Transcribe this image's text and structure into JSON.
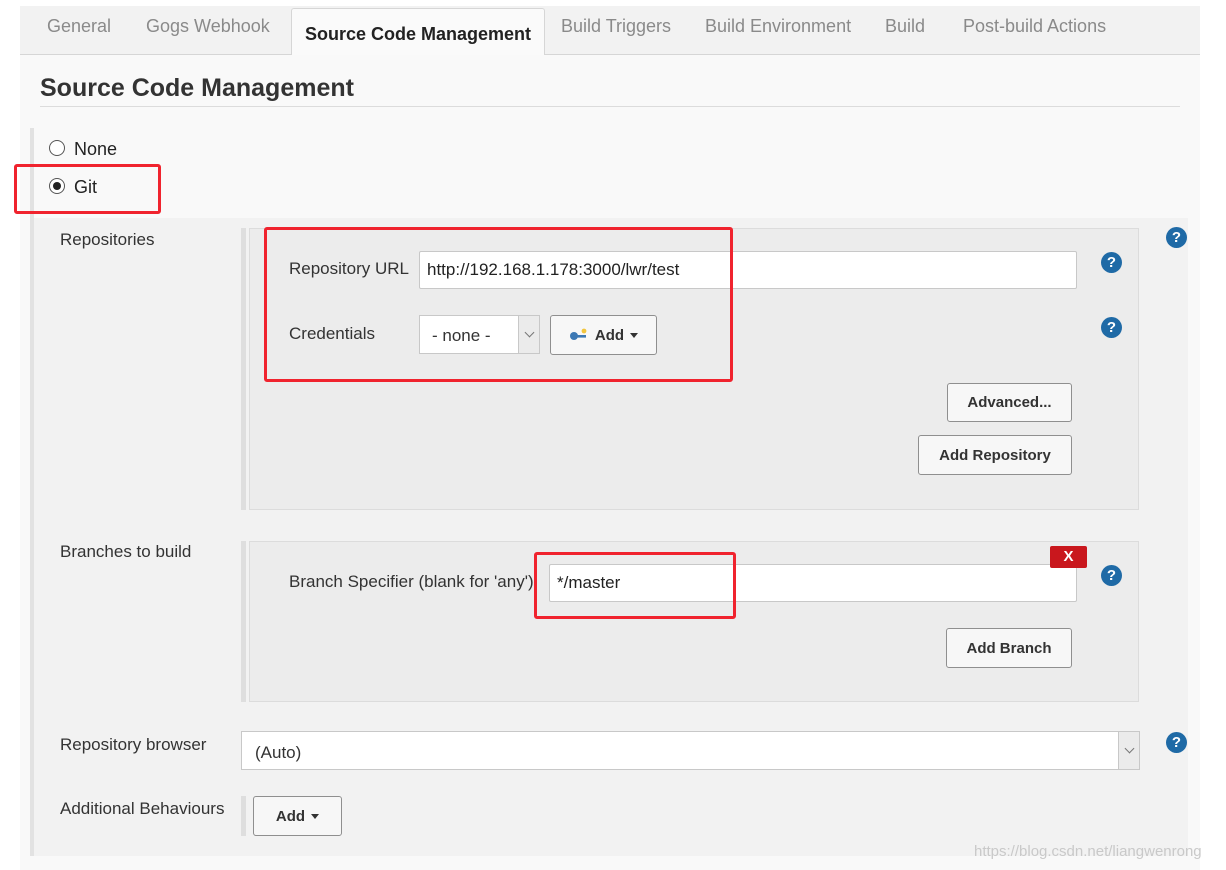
{
  "tabs": [
    {
      "label": "General"
    },
    {
      "label": "Gogs Webhook"
    },
    {
      "label": "Source Code Management"
    },
    {
      "label": "Build Triggers"
    },
    {
      "label": "Build Environment"
    },
    {
      "label": "Build"
    },
    {
      "label": "Post-build Actions"
    }
  ],
  "active_tab": "Source Code Management",
  "section": {
    "title": "Source Code Management"
  },
  "scm_options": [
    {
      "label": "None",
      "selected": false
    },
    {
      "label": "Git",
      "selected": true
    }
  ],
  "repositories": {
    "label": "Repositories",
    "url_label": "Repository URL",
    "url_value": "http://192.168.1.178:3000/lwr/test",
    "credentials_label": "Credentials",
    "credentials_value": "- none -",
    "add_credentials_label": "Add",
    "advanced_label": "Advanced...",
    "add_repository_label": "Add Repository"
  },
  "branches": {
    "label": "Branches to build",
    "specifier_label": "Branch Specifier (blank for 'any')",
    "specifier_value": "*/master",
    "delete_label": "X",
    "add_branch_label": "Add Branch"
  },
  "repository_browser": {
    "label": "Repository browser",
    "value": "(Auto)"
  },
  "additional_behaviours": {
    "label": "Additional Behaviours",
    "add_label": "Add"
  },
  "help_icon_text": "?",
  "watermark": "https://blog.csdn.net/liangwenrong",
  "colors": {
    "help_blue": "#1f6aa6",
    "annotation_red": "#f0232e",
    "delete_red": "#c9171d"
  }
}
